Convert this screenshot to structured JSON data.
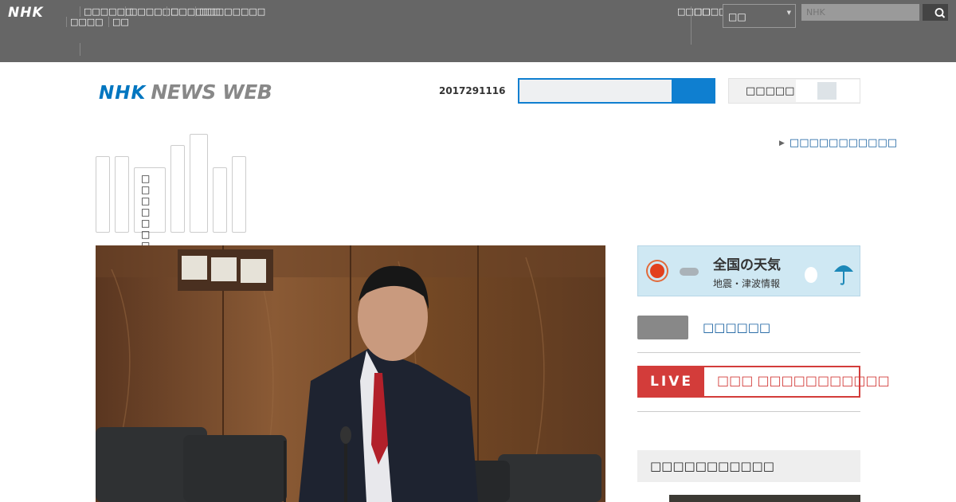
{
  "global_nav": {
    "logo": "NHK",
    "items": [
      "□□□□",
      "□□□□□□",
      "□□",
      "□□□□□□",
      "□□□□□□",
      "□□□□□□□□"
    ],
    "utility": [
      "□□□□",
      "□□□□□"
    ],
    "region_value": "□□",
    "search_placeholder": "NHK"
  },
  "header": {
    "brand_nhk": "NHK",
    "brand_news": "NEWS WEB",
    "date": "2017291116",
    "toggle_label": "□□□□□"
  },
  "categories": [
    {
      "label": ""
    },
    {
      "label": ""
    },
    {
      "label": "□□□□□□□□"
    },
    {
      "label": ""
    },
    {
      "label": ""
    },
    {
      "label": ""
    },
    {
      "label": ""
    }
  ],
  "sub_link": "□□□□□□□□□□□",
  "sidebar": {
    "weather_title": "全国の天気",
    "weather_sub": "地震・津波情報",
    "history_link": "□□□□□□",
    "live_tag": "LIVE",
    "live_title": "□□□ □□□□□□□□□□□",
    "ranking_title": "□□□□□□□□□□□"
  },
  "colors": {
    "topbar": "#666666",
    "brand_blue": "#0076c0",
    "search_blue": "#0f7fd0",
    "live_red": "#d33c3a",
    "link_blue": "#0f5a9c"
  }
}
